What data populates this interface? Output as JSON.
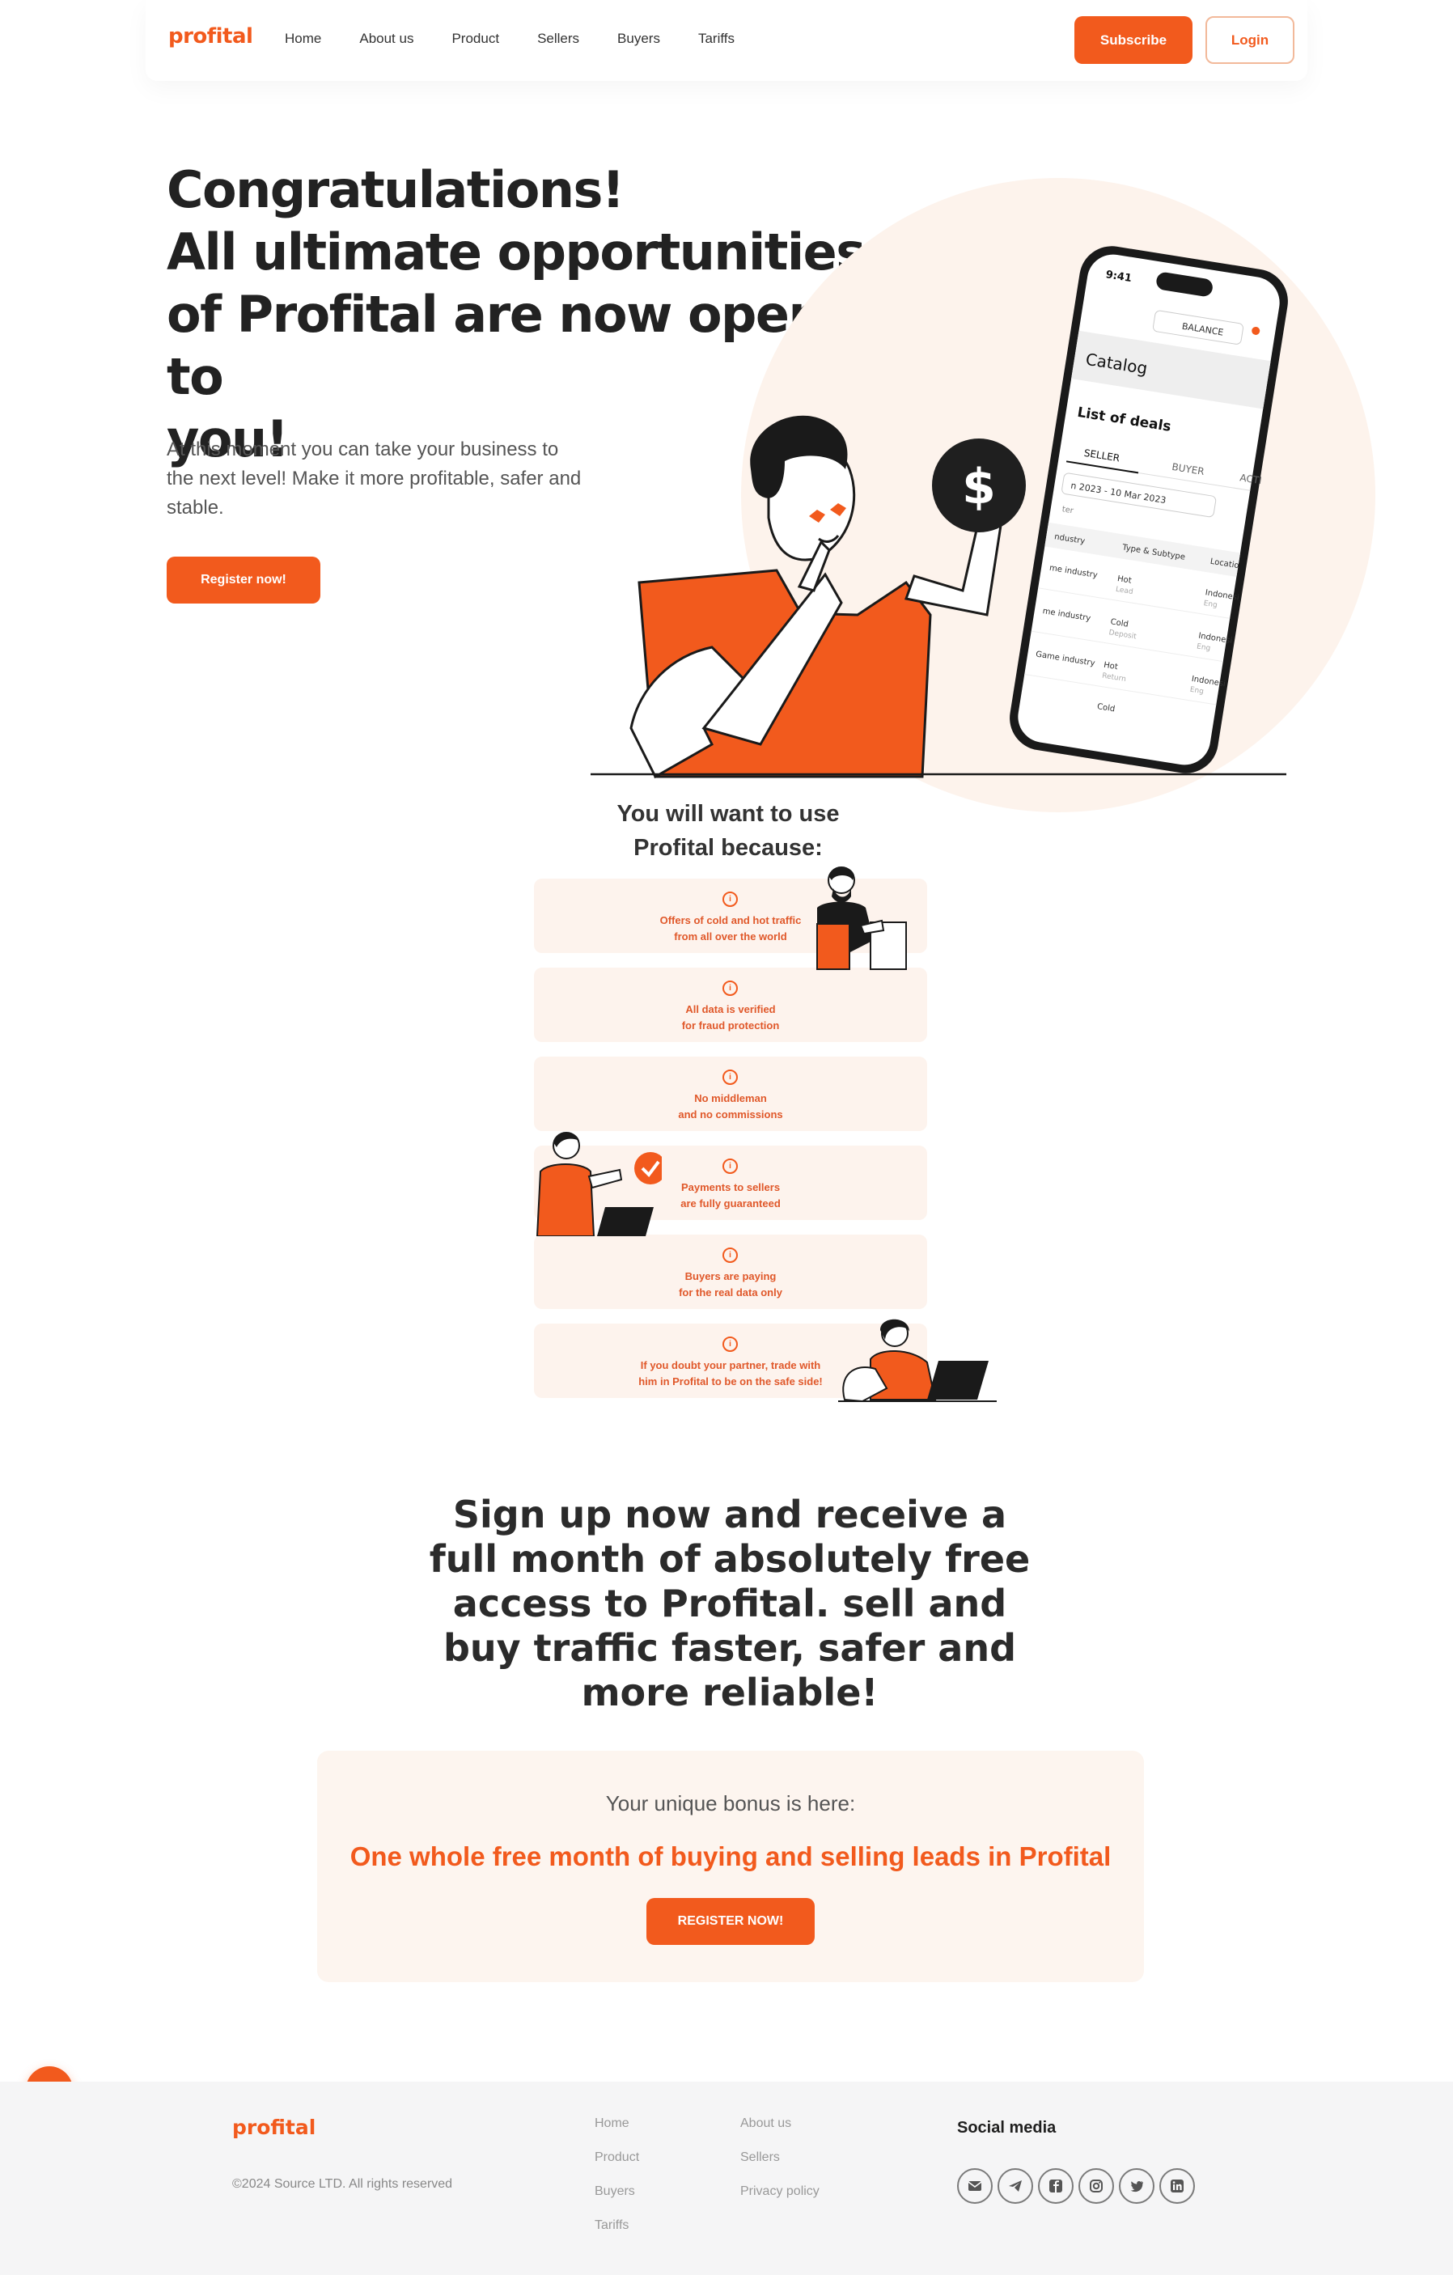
{
  "brand": {
    "logo": "profital",
    "accent_color": "#f25a1d",
    "soft_bg_color": "#fdf3ed"
  },
  "nav": {
    "links": [
      "Home",
      "About us",
      "Product",
      "Sellers",
      "Buyers",
      "Tariffs"
    ],
    "subscribe_label": "Subscribe",
    "login_label": "Login"
  },
  "hero": {
    "title_line1": "Congratulations!",
    "title_line2": "All ultimate opportunities",
    "title_line3": "of Profital are now open to",
    "title_line4": "you!",
    "subtitle": "At this moment you can take your business to the next level! Make it more profitable, safer and stable.",
    "register_label": "Register now!"
  },
  "phone": {
    "time": "9:41",
    "balance_label": "BALANCE",
    "catalog_title": "Catalog",
    "list_title": "List of deals",
    "tabs": [
      "SELLER",
      "BUYER",
      "ACTI"
    ],
    "date_range": "n 2023 - 10 Mar 2023",
    "filter_label": "ter",
    "columns": [
      "ndustry",
      "Type & Subtype",
      "Locatio"
    ],
    "rows": [
      {
        "industry": "me industry",
        "type": "Hot",
        "subtype": "Lead",
        "location": "Indonesi",
        "lang": "Eng"
      },
      {
        "industry": "me industry",
        "type": "Cold",
        "subtype": "Deposit",
        "location": "Indonesi",
        "lang": "Eng"
      },
      {
        "industry": "Game industry",
        "type": "Hot",
        "subtype": "Return",
        "location": "Indonesi",
        "lang": "Eng"
      }
    ],
    "cut_row_label": "Cold"
  },
  "why": {
    "title_line1": "You will want to use",
    "title_line2": "Profital because:",
    "features": [
      {
        "icon": "info-icon",
        "text": "Offers of cold and hot traffic\nfrom all over the world"
      },
      {
        "icon": "info-icon",
        "text": "All data is verified\nfor fraud protection"
      },
      {
        "icon": "info-icon",
        "text": "No middleman\nand no commissions"
      },
      {
        "icon": "info-icon",
        "text": "Payments to sellers\nare fully guaranteed"
      },
      {
        "icon": "info-icon",
        "text": "Buyers are paying\nfor the real data only"
      },
      {
        "icon": "info-icon",
        "text": "If you doubt your partner, trade with\nhim in Profital to be on the safe side!"
      }
    ]
  },
  "cta": {
    "title": "Sign up now and receive a full month of absolutely free access to Profital. sell and buy traffic faster, safer and more reliable!",
    "bonus_lead": "Your unique bonus is here:",
    "bonus_offer": "One whole free month of buying and selling leads in Profital",
    "register_label": "REGISTER NOW!"
  },
  "footer": {
    "logo": "profital",
    "copyright": "©2024 Source LTD. All rights reserved",
    "col1": [
      "Home",
      "Product",
      "Buyers",
      "Tariffs"
    ],
    "col2": [
      "About us",
      "Sellers",
      "Privacy policy"
    ],
    "social_title": "Social media",
    "social_icons": [
      "email-icon",
      "telegram-icon",
      "facebook-icon",
      "instagram-icon",
      "twitter-icon",
      "linkedin-icon"
    ]
  }
}
